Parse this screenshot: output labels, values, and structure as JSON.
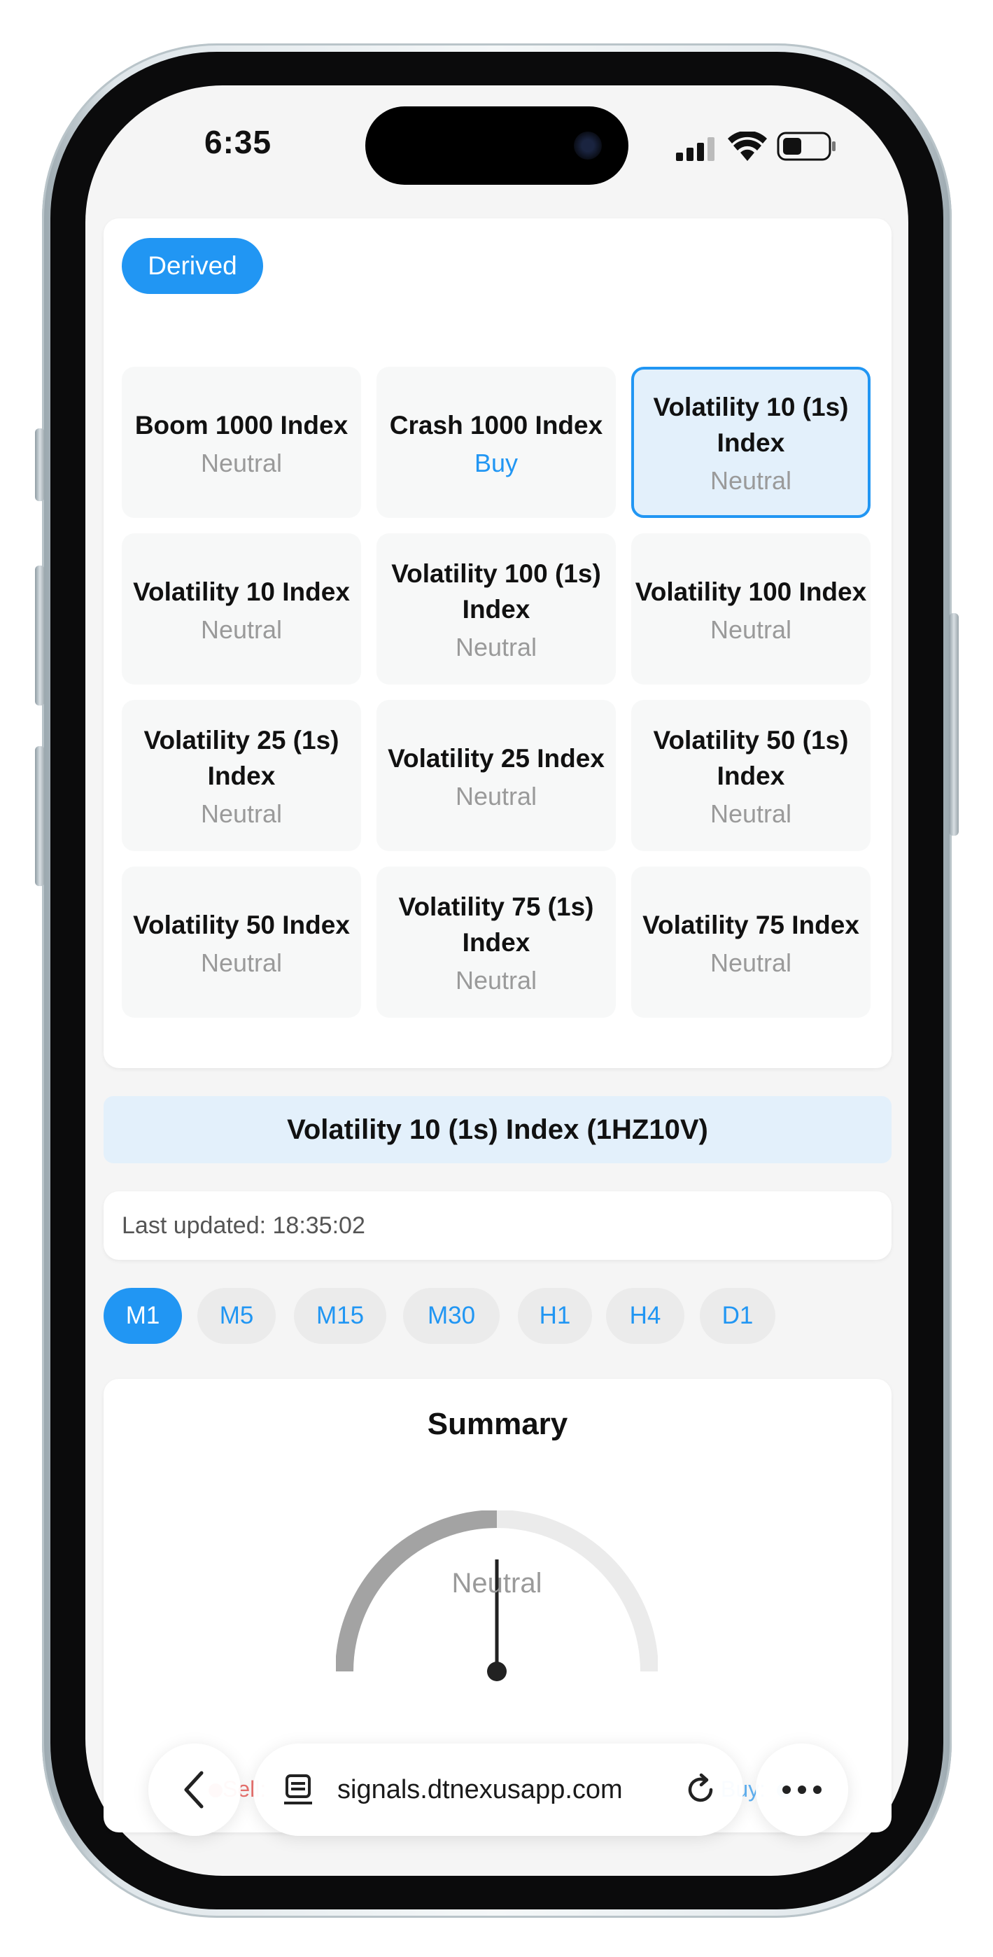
{
  "status_bar": {
    "time": "6:35"
  },
  "category": {
    "label": "Derived"
  },
  "symbols": [
    {
      "name": "Boom 1000 Index",
      "signal": "Neutral",
      "selected": false
    },
    {
      "name": "Crash 1000 Index",
      "signal": "Buy",
      "selected": false
    },
    {
      "name": "Volatility 10 (1s) Index",
      "signal": "Neutral",
      "selected": true
    },
    {
      "name": "Volatility 10 Index",
      "signal": "Neutral",
      "selected": false
    },
    {
      "name": "Volatility 100 (1s) Index",
      "signal": "Neutral",
      "selected": false
    },
    {
      "name": "Volatility 100 Index",
      "signal": "Neutral",
      "selected": false
    },
    {
      "name": "Volatility 25 (1s) Index",
      "signal": "Neutral",
      "selected": false
    },
    {
      "name": "Volatility 25 Index",
      "signal": "Neutral",
      "selected": false
    },
    {
      "name": "Volatility 50 (1s) Index",
      "signal": "Neutral",
      "selected": false
    },
    {
      "name": "Volatility 50 Index",
      "signal": "Neutral",
      "selected": false
    },
    {
      "name": "Volatility 75 (1s) Index",
      "signal": "Neutral",
      "selected": false
    },
    {
      "name": "Volatility 75 Index",
      "signal": "Neutral",
      "selected": false
    }
  ],
  "selected_banner": "Volatility 10 (1s) Index (1HZ10V)",
  "last_updated": "Last updated: 18:35:02",
  "timeframes": [
    {
      "label": "M1",
      "active": true
    },
    {
      "label": "M5",
      "active": false
    },
    {
      "label": "M15",
      "active": false
    },
    {
      "label": "M30",
      "active": false
    },
    {
      "label": "H1",
      "active": false
    },
    {
      "label": "H4",
      "active": false
    },
    {
      "label": "D1",
      "active": false
    }
  ],
  "summary": {
    "title": "Summary",
    "gauge_label": "Neutral",
    "gauge_value": 0.5,
    "sell_label": "Sell:",
    "buy_label": "Buy:"
  },
  "browser": {
    "url": "signals.dtnexusapp.com"
  },
  "colors": {
    "accent": "#2196f3",
    "sell": "#e53935",
    "neutral": "#9a9a9a"
  }
}
